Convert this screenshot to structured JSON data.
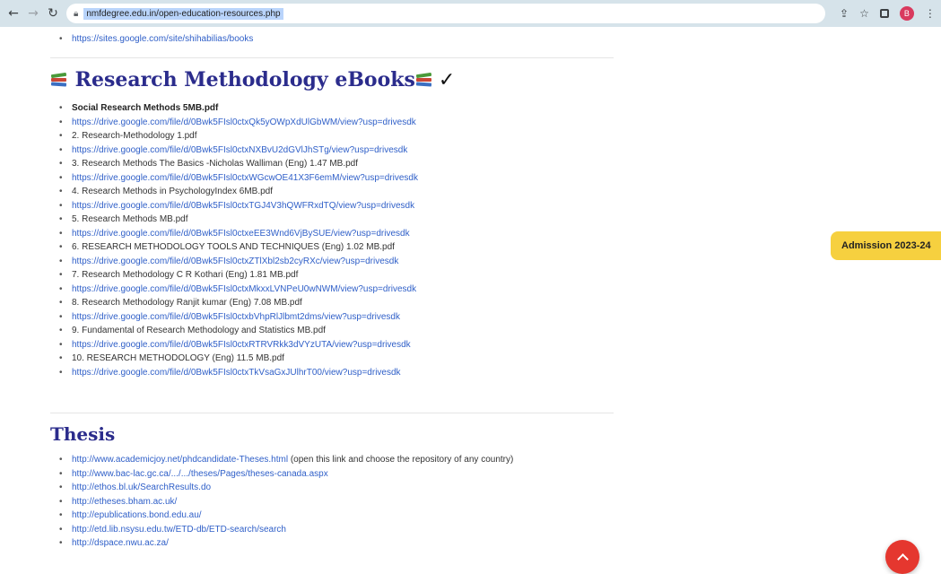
{
  "browser": {
    "url": "nmfdegree.edu.in/open-education-resources.php",
    "avatar_letter": "B"
  },
  "top_link": "https://sites.google.com/site/shihabilias/books",
  "ebooks": {
    "title": "Research Methodology eBooks",
    "items": [
      {
        "text": "Social Research Methods 5MB.pdf"
      },
      {
        "text": "https://drive.google.com/file/d/0Bwk5FIsl0ctxQk5yOWpXdUlGbWM/view?usp=drivesdk"
      },
      {
        "text": "2. Research-Methodology 1.pdf"
      },
      {
        "text": "https://drive.google.com/file/d/0Bwk5FIsl0ctxNXBvU2dGVlJhSTg/view?usp=drivesdk"
      },
      {
        "text": "3. Research Methods The Basics -Nicholas Walliman (Eng) 1.47 MB.pdf"
      },
      {
        "text": "https://drive.google.com/file/d/0Bwk5FIsl0ctxWGcwOE41X3F6emM/view?usp=drivesdk"
      },
      {
        "text": "4. Research Methods in PsychologyIndex 6MB.pdf"
      },
      {
        "text": "https://drive.google.com/file/d/0Bwk5FIsl0ctxTGJ4V3hQWFRxdTQ/view?usp=drivesdk"
      },
      {
        "text": "5. Research Methods MB.pdf"
      },
      {
        "text": "https://drive.google.com/file/d/0Bwk5FIsl0ctxeEE3Wnd6VjBySUE/view?usp=drivesdk"
      },
      {
        "text": "6. RESEARCH METHODOLOGY TOOLS AND TECHNIQUES (Eng) 1.02 MB.pdf"
      },
      {
        "text": "https://drive.google.com/file/d/0Bwk5FIsl0ctxZTlXbl2sb2cyRXc/view?usp=drivesdk"
      },
      {
        "text": "7. Research Methodology C R Kothari (Eng) 1.81 MB.pdf"
      },
      {
        "text": "https://drive.google.com/file/d/0Bwk5FIsl0ctxMkxxLVNPeU0wNWM/view?usp=drivesdk"
      },
      {
        "text": "8. Research Methodology Ranjit kumar (Eng) 7.08 MB.pdf"
      },
      {
        "text": "https://drive.google.com/file/d/0Bwk5FIsl0ctxbVhpRlJlbmt2dms/view?usp=drivesdk"
      },
      {
        "text": "9. Fundamental of Research Methodology and Statistics MB.pdf"
      },
      {
        "text": "https://drive.google.com/file/d/0Bwk5FIsl0ctxRTRVRkk3dVYzUTA/view?usp=drivesdk"
      },
      {
        "text": "10. RESEARCH METHODOLOGY (Eng) 11.5 MB.pdf"
      },
      {
        "text": "https://drive.google.com/file/d/0Bwk5FIsl0ctxTkVsaGxJUlhrT00/view?usp=drivesdk"
      }
    ]
  },
  "thesis": {
    "title": "Thesis",
    "first_link": "http://www.academicjoy.net/phdcandidate-Theses.html",
    "first_note": "(open this link and choose the repository of any country)",
    "links": [
      "http://www.bac-lac.gc.ca/.../.../theses/Pages/theses-canada.aspx",
      "http://ethos.bl.uk/SearchResults.do",
      "http://etheses.bham.ac.uk/",
      "http://epublications.bond.edu.au/",
      "http://etd.lib.nsysu.edu.tw/ETD-db/ETD-search/search",
      "http://dspace.nwu.ac.za/"
    ]
  },
  "admission_label": "Admission 2023-24"
}
